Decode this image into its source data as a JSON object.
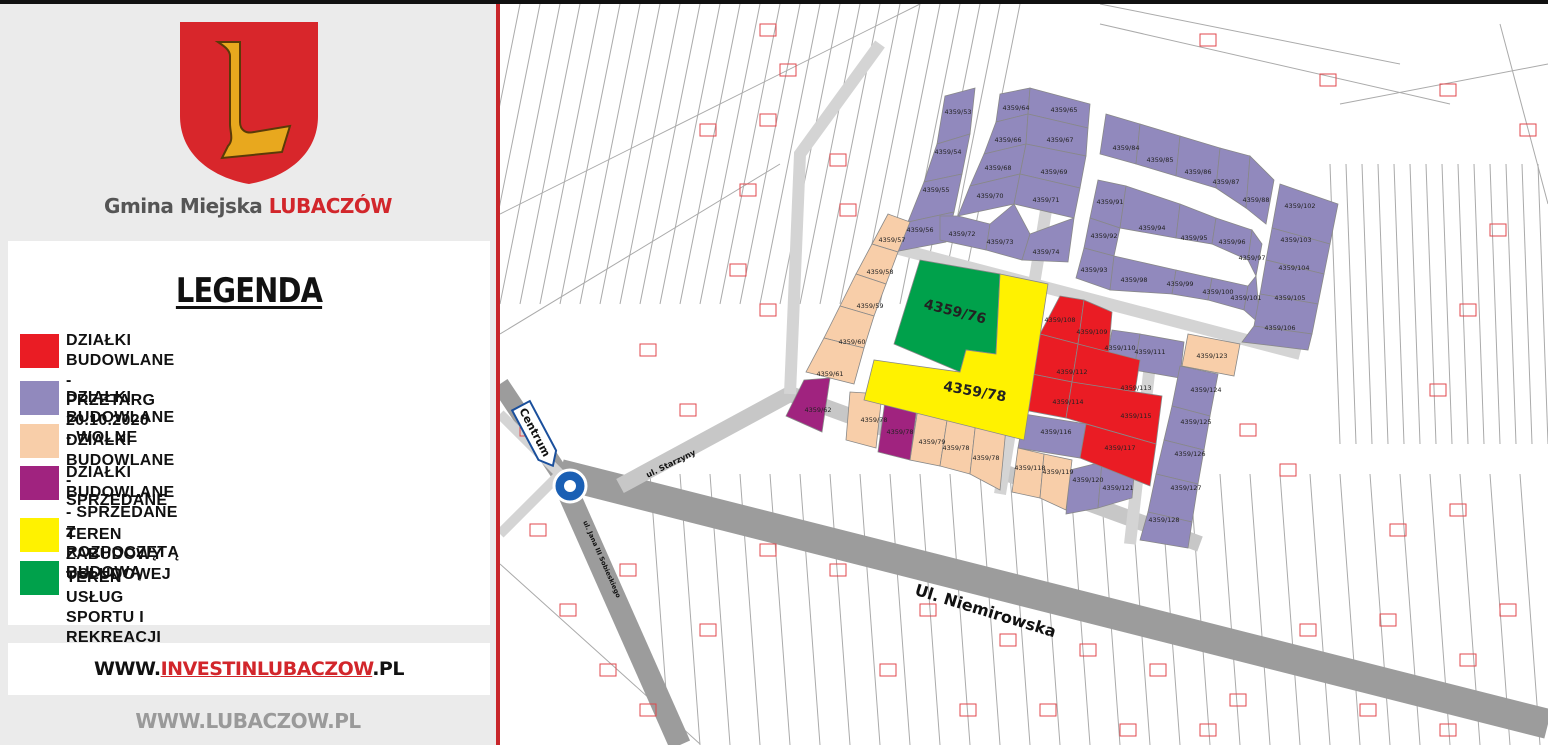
{
  "header": {
    "brand_prefix": "Gmina Miejska ",
    "brand_highlight": "LUBACZÓW",
    "crest_letter": "L"
  },
  "legend": {
    "title": "LEGENDA",
    "items": [
      {
        "label": "DZIAŁKI BUDOWLANE -\nPRZETARG 20.10.2020",
        "color": "#ea1c24"
      },
      {
        "label": "DZIAŁKI BUDOWLANE - WOLNE",
        "color": "#9189bd"
      },
      {
        "label": "DZIAŁKI BUDOWLANE - SPRZEDANE",
        "color": "#f8cea9"
      },
      {
        "label": "DZIAŁKI BUDOWLANE - SPRZEDANE\nZ ROZPOCZĘTĄ BUDOWĄ",
        "color": "#a0237f"
      },
      {
        "label": "TEREN ZABUDOWY USŁUDOWEJ",
        "color": "#fff200"
      },
      {
        "label": "TEREN USŁUG SPORTU I REKREACJI",
        "color": "#00a14b"
      }
    ]
  },
  "links": {
    "invest_prefix": "WWW.",
    "invest_highlight": "INVESTINLUBACZOW",
    "invest_suffix": ".PL",
    "city": "WWW.LUBACZOW.PL"
  },
  "map": {
    "streets": {
      "niemirowska": "Ul. Niemirowska",
      "starzyny": "ul. Starzyny",
      "jana_pawla": "ul. Jana III Sobieskiego",
      "centrum": "Centrum"
    },
    "big_labels": {
      "sport": "4359/76",
      "service": "4359/78"
    },
    "plots": {
      "wolne": [
        "4359/53",
        "4359/54",
        "4359/55",
        "4359/56",
        "4359/64",
        "4359/65",
        "4359/66",
        "4359/67",
        "4359/68",
        "4359/69",
        "4359/70",
        "4359/71",
        "4359/72",
        "4359/73",
        "4359/74",
        "4359/84",
        "4359/85",
        "4359/86",
        "4359/87",
        "4359/88",
        "4359/91",
        "4359/92",
        "4359/93",
        "4359/94",
        "4359/95",
        "4359/96",
        "4359/97",
        "4359/98",
        "4359/99",
        "4359/100",
        "4359/101",
        "4359/102",
        "4359/103",
        "4359/104",
        "4359/105",
        "4359/106",
        "4359/110",
        "4359/111",
        "4359/116",
        "4359/120",
        "4359/121",
        "4359/124",
        "4359/125",
        "4359/126",
        "4359/127",
        "4359/128"
      ],
      "sprzedane": [
        "4359/57",
        "4359/58",
        "4359/59",
        "4359/60",
        "4359/61",
        "4359/78",
        "4359/79",
        "4359/78",
        "4359/78",
        "4359/118",
        "4359/119",
        "4359/123"
      ],
      "budowa": [
        "4359/62",
        "4359/78"
      ],
      "przetarg": [
        "4359/108",
        "4359/109",
        "4359/112",
        "4359/113",
        "4359/114",
        "4359/115",
        "4359/117"
      ]
    }
  }
}
